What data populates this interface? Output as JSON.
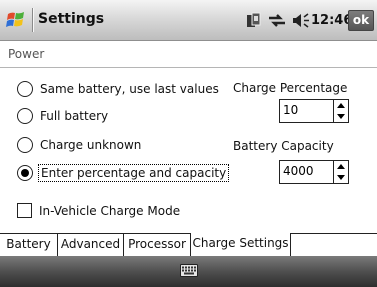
{
  "titlebar": {
    "app_title": "Settings",
    "time": "12:46",
    "ok_label": "ok",
    "icons": [
      "windows-start-icon",
      "sync-icon",
      "signal-icon",
      "volume-icon"
    ]
  },
  "page": {
    "title": "Power"
  },
  "options": {
    "radios": [
      {
        "label": "Same battery, use last values",
        "checked": false
      },
      {
        "label": "Full battery",
        "checked": false
      },
      {
        "label": "Charge unknown",
        "checked": false
      },
      {
        "label": "Enter percentage and capacity",
        "checked": true
      }
    ],
    "checkbox": {
      "label": "In-Vehicle Charge Mode",
      "checked": false
    }
  },
  "charge_percentage": {
    "label": "Charge Percentage",
    "value": "10"
  },
  "battery_capacity": {
    "label": "Battery Capacity",
    "value": "4000"
  },
  "tabs": [
    {
      "label": "Battery",
      "active": false
    },
    {
      "label": "Advanced",
      "active": false
    },
    {
      "label": "Processor",
      "active": false
    },
    {
      "label": "Charge Settings",
      "active": true
    }
  ],
  "softbar": {
    "icon": "keyboard-icon"
  },
  "colors": {
    "titlebar_top": "#f4f4f4",
    "titlebar_bottom": "#bdbdbd",
    "softbar": "#4f4f4f",
    "ok_button": "#666666"
  }
}
